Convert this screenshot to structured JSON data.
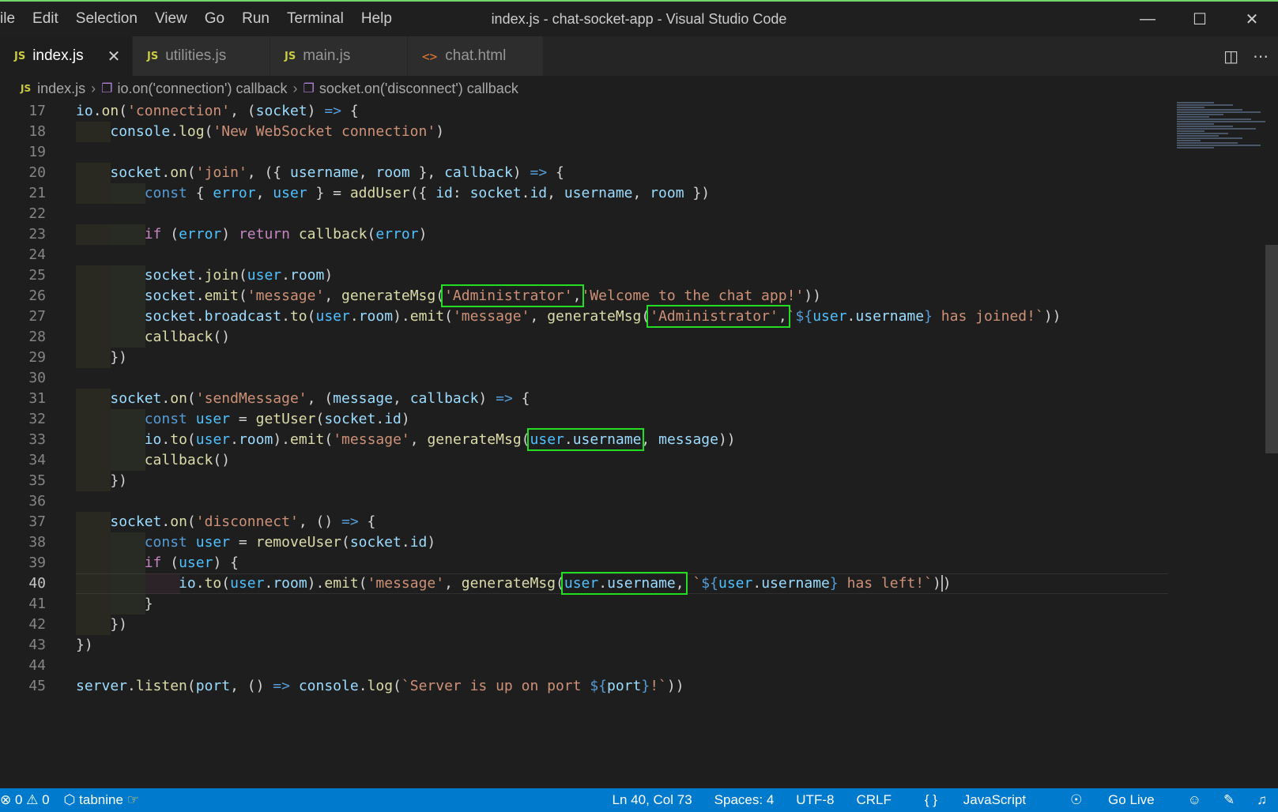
{
  "menu": [
    "ile",
    "Edit",
    "Selection",
    "View",
    "Go",
    "Run",
    "Terminal",
    "Help"
  ],
  "window_title": "index.js - chat-socket-app - Visual Studio Code",
  "tabs": [
    {
      "icon": "JS",
      "label": "index.js",
      "active": true
    },
    {
      "icon": "JS",
      "label": "utilities.js"
    },
    {
      "icon": "JS",
      "label": "main.js"
    },
    {
      "icon": "<>",
      "label": "chat.html"
    }
  ],
  "breadcrumb": {
    "file": "index.js",
    "items": [
      "io.on('connection') callback",
      "socket.on('disconnect') callback"
    ]
  },
  "editor": {
    "line_numbers": [
      "17",
      "18",
      "19",
      "20",
      "21",
      "22",
      "23",
      "24",
      "25",
      "26",
      "27",
      "28",
      "29",
      "30",
      "31",
      "32",
      "33",
      "34",
      "35",
      "36",
      "37",
      "38",
      "39",
      "40",
      "41",
      "42",
      "43",
      "44",
      "45"
    ],
    "current_line": "40"
  },
  "status": {
    "errors": "0",
    "warnings": "0",
    "tabnine": "tabnine",
    "position": "Ln 40, Col 73",
    "spaces": "Spaces: 4",
    "encoding": "UTF-8",
    "eol": "CRLF",
    "language": "JavaScript",
    "golive": "Go Live"
  }
}
